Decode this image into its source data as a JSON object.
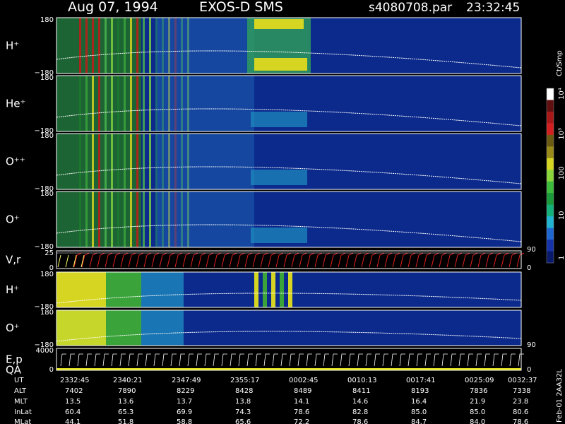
{
  "header": {
    "date": "Aug 07, 1994",
    "instrument": "EXOS-D SMS",
    "file": "s4080708.par",
    "time": "23:32:45"
  },
  "colorbar": {
    "unit": "Ct/Smp",
    "labels": [
      "1",
      "10",
      "100",
      "10³",
      "10⁴"
    ]
  },
  "side_labels": {
    "vertical_stamp": "Feb-01 2AA32L"
  },
  "chart_data": {
    "type": "heatmap",
    "colorscale": "log counts per sample, 1 to 10^4",
    "panels": [
      {
        "label": "H⁺",
        "ymax": "180",
        "ymin": "−180"
      },
      {
        "label": "He⁺",
        "ymax": "180",
        "ymin": "−180"
      },
      {
        "label": "O⁺⁺",
        "ymax": "180",
        "ymin": "−180"
      },
      {
        "label": "O⁺",
        "ymax": "180",
        "ymin": "−180"
      },
      {
        "label": "V,r",
        "ymax": "25",
        "ymin": "0",
        "right_top": "90",
        "right_bottom": "0"
      },
      {
        "label": "H⁺",
        "ymax": "180",
        "ymin": "−180"
      },
      {
        "label": "O⁺",
        "ymax": "180",
        "ymin": "−180",
        "right_bottom": "90"
      },
      {
        "label": "E,p",
        "label2": "QA",
        "ymax": "4000",
        "ymin": "0",
        "right_bottom": "0"
      }
    ],
    "table": {
      "row_labels": [
        "UT",
        "ALT",
        "MLT",
        "InLat",
        "MLat"
      ],
      "columns": [
        [
          "2332:45",
          "7402",
          "13.5",
          "60.4",
          "44.1"
        ],
        [
          "2340:21",
          "7890",
          "13.6",
          "65.3",
          "51.8"
        ],
        [
          "2347:49",
          "8229",
          "13.7",
          "69.9",
          "58.8"
        ],
        [
          "2355:17",
          "8428",
          "13.8",
          "74.3",
          "65.6"
        ],
        [
          "0002:45",
          "8489",
          "14.1",
          "78.6",
          "72.2"
        ],
        [
          "0010:13",
          "8411",
          "14.6",
          "82.8",
          "78.6"
        ],
        [
          "0017:41",
          "8193",
          "16.4",
          "85.0",
          "84.7"
        ],
        [
          "0025:09",
          "7836",
          "21.9",
          "85.0",
          "84.0"
        ],
        [
          "0032:37",
          "7338",
          "23.8",
          "80.6",
          "78.6"
        ]
      ]
    }
  }
}
